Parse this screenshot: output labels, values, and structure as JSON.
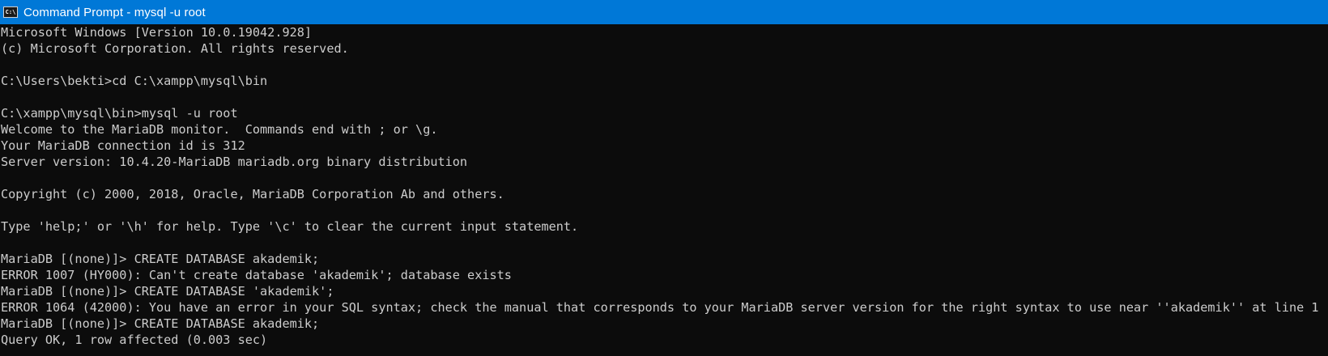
{
  "window": {
    "title": "Command Prompt - mysql  -u root",
    "icon": "command-prompt-icon",
    "icon_glyph": "C:\\",
    "colors": {
      "titlebar": "#0078d7",
      "background": "#0c0c0c",
      "text": "#cccccc"
    }
  },
  "console": {
    "lines": [
      "Microsoft Windows [Version 10.0.19042.928]",
      "(c) Microsoft Corporation. All rights reserved.",
      "",
      "C:\\Users\\bekti>cd C:\\xampp\\mysql\\bin",
      "",
      "C:\\xampp\\mysql\\bin>mysql -u root",
      "Welcome to the MariaDB monitor.  Commands end with ; or \\g.",
      "Your MariaDB connection id is 312",
      "Server version: 10.4.20-MariaDB mariadb.org binary distribution",
      "",
      "Copyright (c) 2000, 2018, Oracle, MariaDB Corporation Ab and others.",
      "",
      "Type 'help;' or '\\h' for help. Type '\\c' to clear the current input statement.",
      "",
      "MariaDB [(none)]> CREATE DATABASE akademik;",
      "ERROR 1007 (HY000): Can't create database 'akademik'; database exists",
      "MariaDB [(none)]> CREATE DATABASE 'akademik';",
      "ERROR 1064 (42000): You have an error in your SQL syntax; check the manual that corresponds to your MariaDB server version for the right syntax to use near ''akademik'' at line 1",
      "MariaDB [(none)]> CREATE DATABASE akademik;",
      "Query OK, 1 row affected (0.003 sec)"
    ]
  }
}
